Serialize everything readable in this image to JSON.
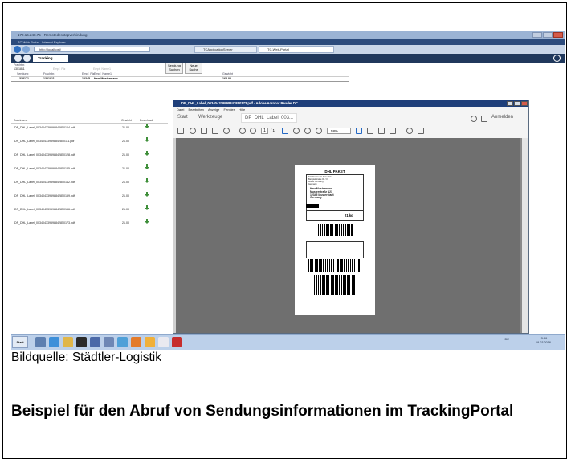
{
  "screenshot": {
    "rd_title": "172.16.248.75 - Remotedesktopverbindung",
    "ie_title": "TC-Web-Portal - Internet Explorer",
    "address": "http://localhost/",
    "ie_tabs": [
      "TCApplicationServer",
      "TC-Web-Portal"
    ],
    "portal_tab": "Tracking",
    "header": {
      "frachtbrief_label": "Frachtbr.",
      "frachtbrief_value": "1301811",
      "empf_plz_label": "Empf. Plz",
      "empf_name_label": "Empf. Name1",
      "btn_suchen": [
        "Sendung",
        "Suchen"
      ],
      "btn_neu": [
        "Neue",
        "Suche"
      ],
      "cols": [
        "Sendung",
        "Frachtbr.",
        "Empf. Plz",
        "Empf. Name1",
        "Gewicht"
      ],
      "row": [
        "338171",
        "1301811",
        "12345",
        "Herr Mustermann",
        "168.00"
      ]
    },
    "table": {
      "cols": [
        "Dateiname",
        "Gewicht",
        "Download"
      ],
      "rows": [
        {
          "name": "DP_DHL_Label_003404339598842850104.pdf",
          "weight": "21.00"
        },
        {
          "name": "DP_DHL_Label_003404339598842850111.pdf",
          "weight": "21.00"
        },
        {
          "name": "DP_DHL_Label_003404339598842850128.pdf",
          "weight": "21.00"
        },
        {
          "name": "DP_DHL_Label_003404339598842850135.pdf",
          "weight": "21.00"
        },
        {
          "name": "DP_DHL_Label_003404339598842850142.pdf",
          "weight": "21.00"
        },
        {
          "name": "DP_DHL_Label_003404339598842850159.pdf",
          "weight": "21.00"
        },
        {
          "name": "DP_DHL_Label_003404339598842850166.pdf",
          "weight": "21.00"
        },
        {
          "name": "DP_DHL_Label_003404339598842850173.pdf",
          "weight": "21.00"
        }
      ]
    },
    "acrobat": {
      "title": "DP_DHL_Label_003404339598842850173.pdf - Adobe Acrobat Reader DC",
      "menu": [
        "Datei",
        "Bearbeiten",
        "Anzeige",
        "Fenster",
        "Hilfe"
      ],
      "tabs": [
        "Start",
        "Werkzeuge",
        "DP_DHL_Label_003..."
      ],
      "signin": "Anmelden",
      "page_num": "1",
      "page_total": "/ 1",
      "zoom": "58%"
    },
    "label": {
      "title": "DHL PAKET",
      "sender": "Städtler GmbH & Co. KG\nBeispielstraße 00 / 0\n90411 Nürnberg\nGermany",
      "recipient": "Herr Mustermann\nMusterstraße 123\n12345 Musterstadt\nGermany",
      "weight": "21 kg"
    },
    "taskbar": {
      "start": "Start",
      "lang": "DE",
      "time": "15:39",
      "date": "19.03.2016"
    }
  },
  "caption": "Bildquelle: Städtler-Logistik",
  "headline": "Beispiel für den Abruf von Sendungsinformationen im TrackingPortal"
}
